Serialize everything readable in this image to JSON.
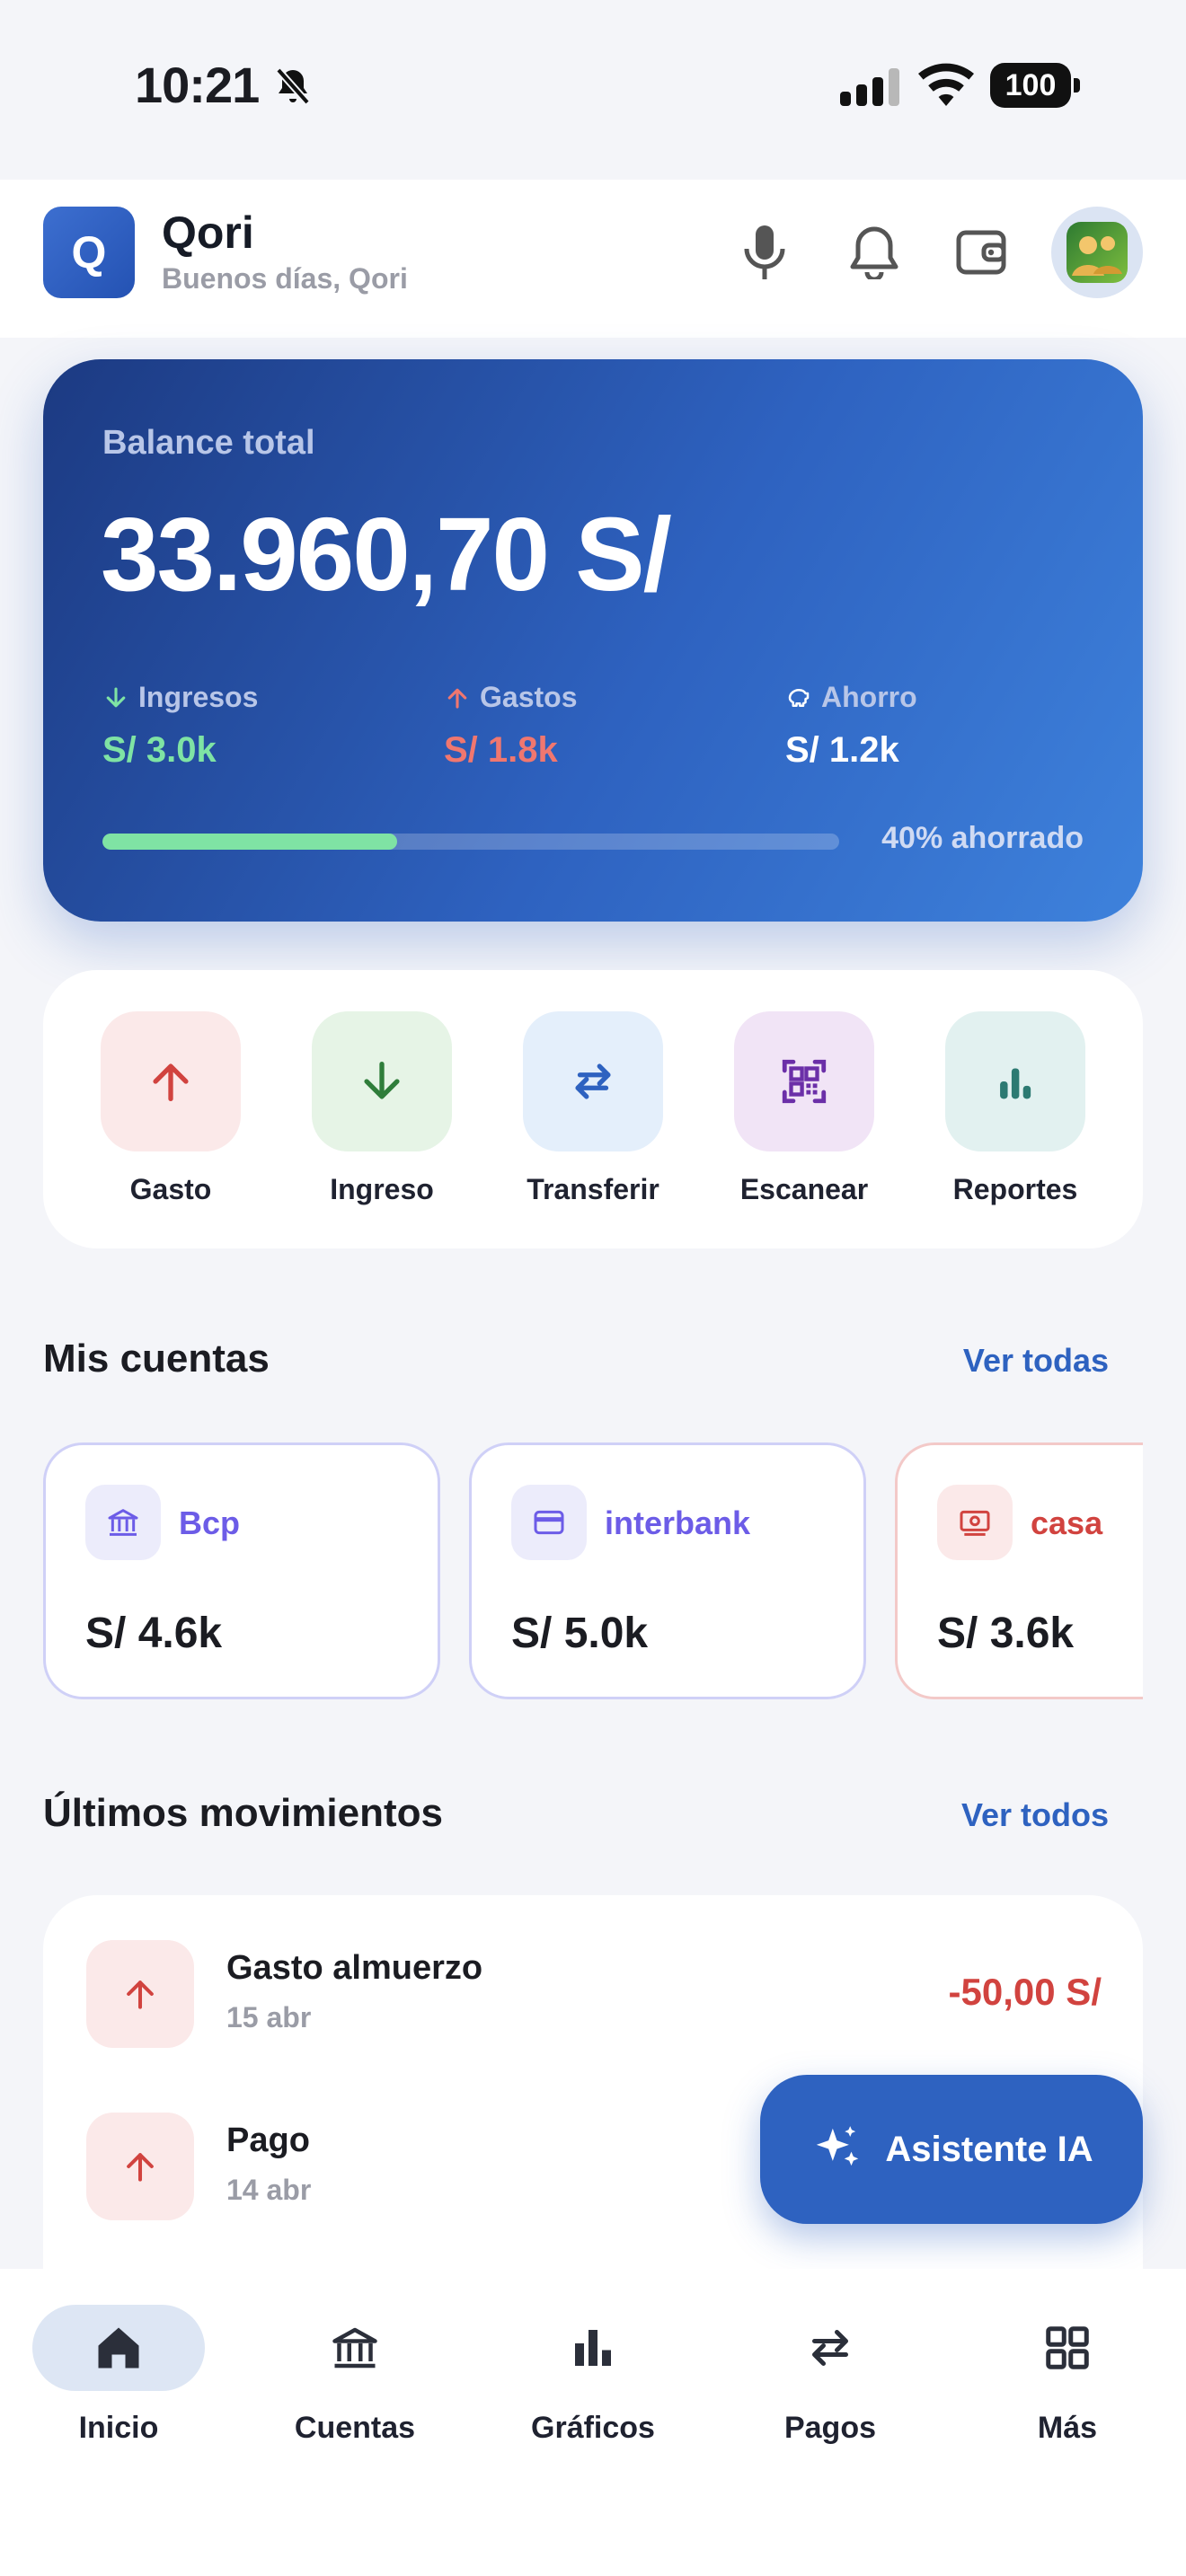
{
  "status_bar": {
    "time": "10:21",
    "battery": "100"
  },
  "header": {
    "logo_letter": "Q",
    "app_name": "Qori",
    "greeting": "Buenos días, Qori",
    "icons": [
      "microphone-icon",
      "bell-icon",
      "wallet-icon",
      "avatar"
    ]
  },
  "balance": {
    "label": "Balance total",
    "amount": "33.960,70 S/",
    "income_label": "Ingresos",
    "income_value": "S/ 3.0k",
    "expense_label": "Gastos",
    "expense_value": "S/ 1.8k",
    "savings_label": "Ahorro",
    "savings_value": "S/ 1.2k",
    "saved_fraction": 0.4,
    "saved_label": "40% ahorrado"
  },
  "actions": [
    {
      "label": "Gasto",
      "icon": "arrow-up-icon",
      "color": "#d1433f",
      "bg": "#fbe9e9"
    },
    {
      "label": "Ingreso",
      "icon": "arrow-down-icon",
      "color": "#2f7d3a",
      "bg": "#e6f4e6"
    },
    {
      "label": "Transferir",
      "icon": "transfer-icon",
      "color": "#2e62c0",
      "bg": "#e4effb"
    },
    {
      "label": "Escanear",
      "icon": "qr-scan-icon",
      "color": "#6b2fa8",
      "bg": "#f1e4f6"
    },
    {
      "label": "Reportes",
      "icon": "bar-chart-icon",
      "color": "#2c7a72",
      "bg": "#e2f1f0"
    }
  ],
  "accounts_section": {
    "title": "Mis cuentas",
    "link": "Ver todas"
  },
  "accounts": [
    {
      "name": "Bcp",
      "balance": "S/ 4.6k",
      "icon": "bank-icon",
      "color": "#6c5ce7"
    },
    {
      "name": "interbank",
      "balance": "S/ 5.0k",
      "icon": "card-icon",
      "color": "#6c5ce7"
    },
    {
      "name": "casa",
      "balance": "S/ 3.6k",
      "icon": "cash-icon",
      "color": "#d1433f"
    }
  ],
  "movements_section": {
    "title": "Últimos movimientos",
    "link": "Ver todos"
  },
  "movements": [
    {
      "title": "Gasto almuerzo",
      "date": "15 abr",
      "amount": "-50,00 S/"
    },
    {
      "title": "Pago",
      "date": "14 abr",
      "amount": ""
    }
  ],
  "fab": {
    "label": "Asistente IA",
    "icon": "sparkles-icon"
  },
  "nav": [
    {
      "label": "Inicio",
      "icon": "home-icon",
      "active": true
    },
    {
      "label": "Cuentas",
      "icon": "bank-icon",
      "active": false
    },
    {
      "label": "Gráficos",
      "icon": "bar-chart-icon",
      "active": false
    },
    {
      "label": "Pagos",
      "icon": "transfer-icon",
      "active": false
    },
    {
      "label": "Más",
      "icon": "grid-icon",
      "active": false
    }
  ],
  "colors": {
    "accent": "#2e62c0",
    "income": "#7fe3a4",
    "expense": "#e8625d"
  }
}
